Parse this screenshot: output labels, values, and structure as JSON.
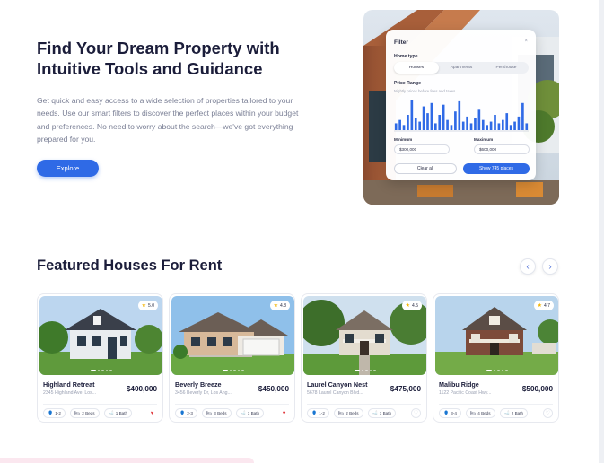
{
  "hero": {
    "title_line1": "Find Your Dream Property with",
    "title_line2": "Intuitive Tools and Guidance",
    "description": "Get quick and easy access to a wide selection of properties tailored to your needs. Use our smart filters to discover the perfect places within your budget and preferences. No need to worry about the search—we've got everything prepared for you.",
    "cta_label": "Explore"
  },
  "filter": {
    "title": "Filter",
    "close": "×",
    "home_type_label": "Home type",
    "home_types": [
      "Houses",
      "Apartments",
      "Penthouse"
    ],
    "selected_home_type": "Houses",
    "price_range_label": "Price Range",
    "price_range_hint": "Nightly prices before fees and taxes",
    "histogram": [
      4,
      6,
      3,
      9,
      18,
      7,
      5,
      14,
      10,
      16,
      4,
      9,
      15,
      6,
      3,
      11,
      17,
      5,
      8,
      4,
      7,
      12,
      6,
      3,
      5,
      9,
      4,
      6,
      10,
      3,
      5,
      8,
      16,
      4
    ],
    "minimum_label": "Minimum",
    "minimum_value": "$300,000",
    "maximum_label": "Maximum",
    "maximum_value": "$600,000",
    "clear_label": "Clear all",
    "show_label": "Show 745 places"
  },
  "featured": {
    "title": "Featured Houses For Rent",
    "prev_icon": "chevron-left-icon",
    "next_icon": "chevron-right-icon",
    "cards": [
      {
        "name": "Highland Retreat",
        "address": "2345 Highland Ave, Los...",
        "price": "$400,000",
        "rating": "5.0",
        "guests": "1-2",
        "beds": "2 Beds",
        "baths": "1 Bath",
        "favorite": true
      },
      {
        "name": "Beverly Breeze",
        "address": "3456 Beverly Dr, Los Ang...",
        "price": "$450,000",
        "rating": "4.8",
        "guests": "2-3",
        "beds": "3 Beds",
        "baths": "1 Bath",
        "favorite": true
      },
      {
        "name": "Laurel Canyon Nest",
        "address": "5678 Laurel Canyon Blvd...",
        "price": "$475,000",
        "rating": "4.5",
        "guests": "1-2",
        "beds": "2 Beds",
        "baths": "1 Bath",
        "favorite": false
      },
      {
        "name": "Malibu Ridge",
        "address": "1122 Pacific Coast Hwy...",
        "price": "$500,000",
        "rating": "4.7",
        "guests": "3-4",
        "beds": "4 Beds",
        "baths": "2 Bath",
        "favorite": false
      }
    ]
  },
  "colors": {
    "accent": "#2f6ae6",
    "heading": "#1b1d3a",
    "body_text": "#7a7f95",
    "favorite": "#e0393e",
    "star": "#f4b400"
  }
}
